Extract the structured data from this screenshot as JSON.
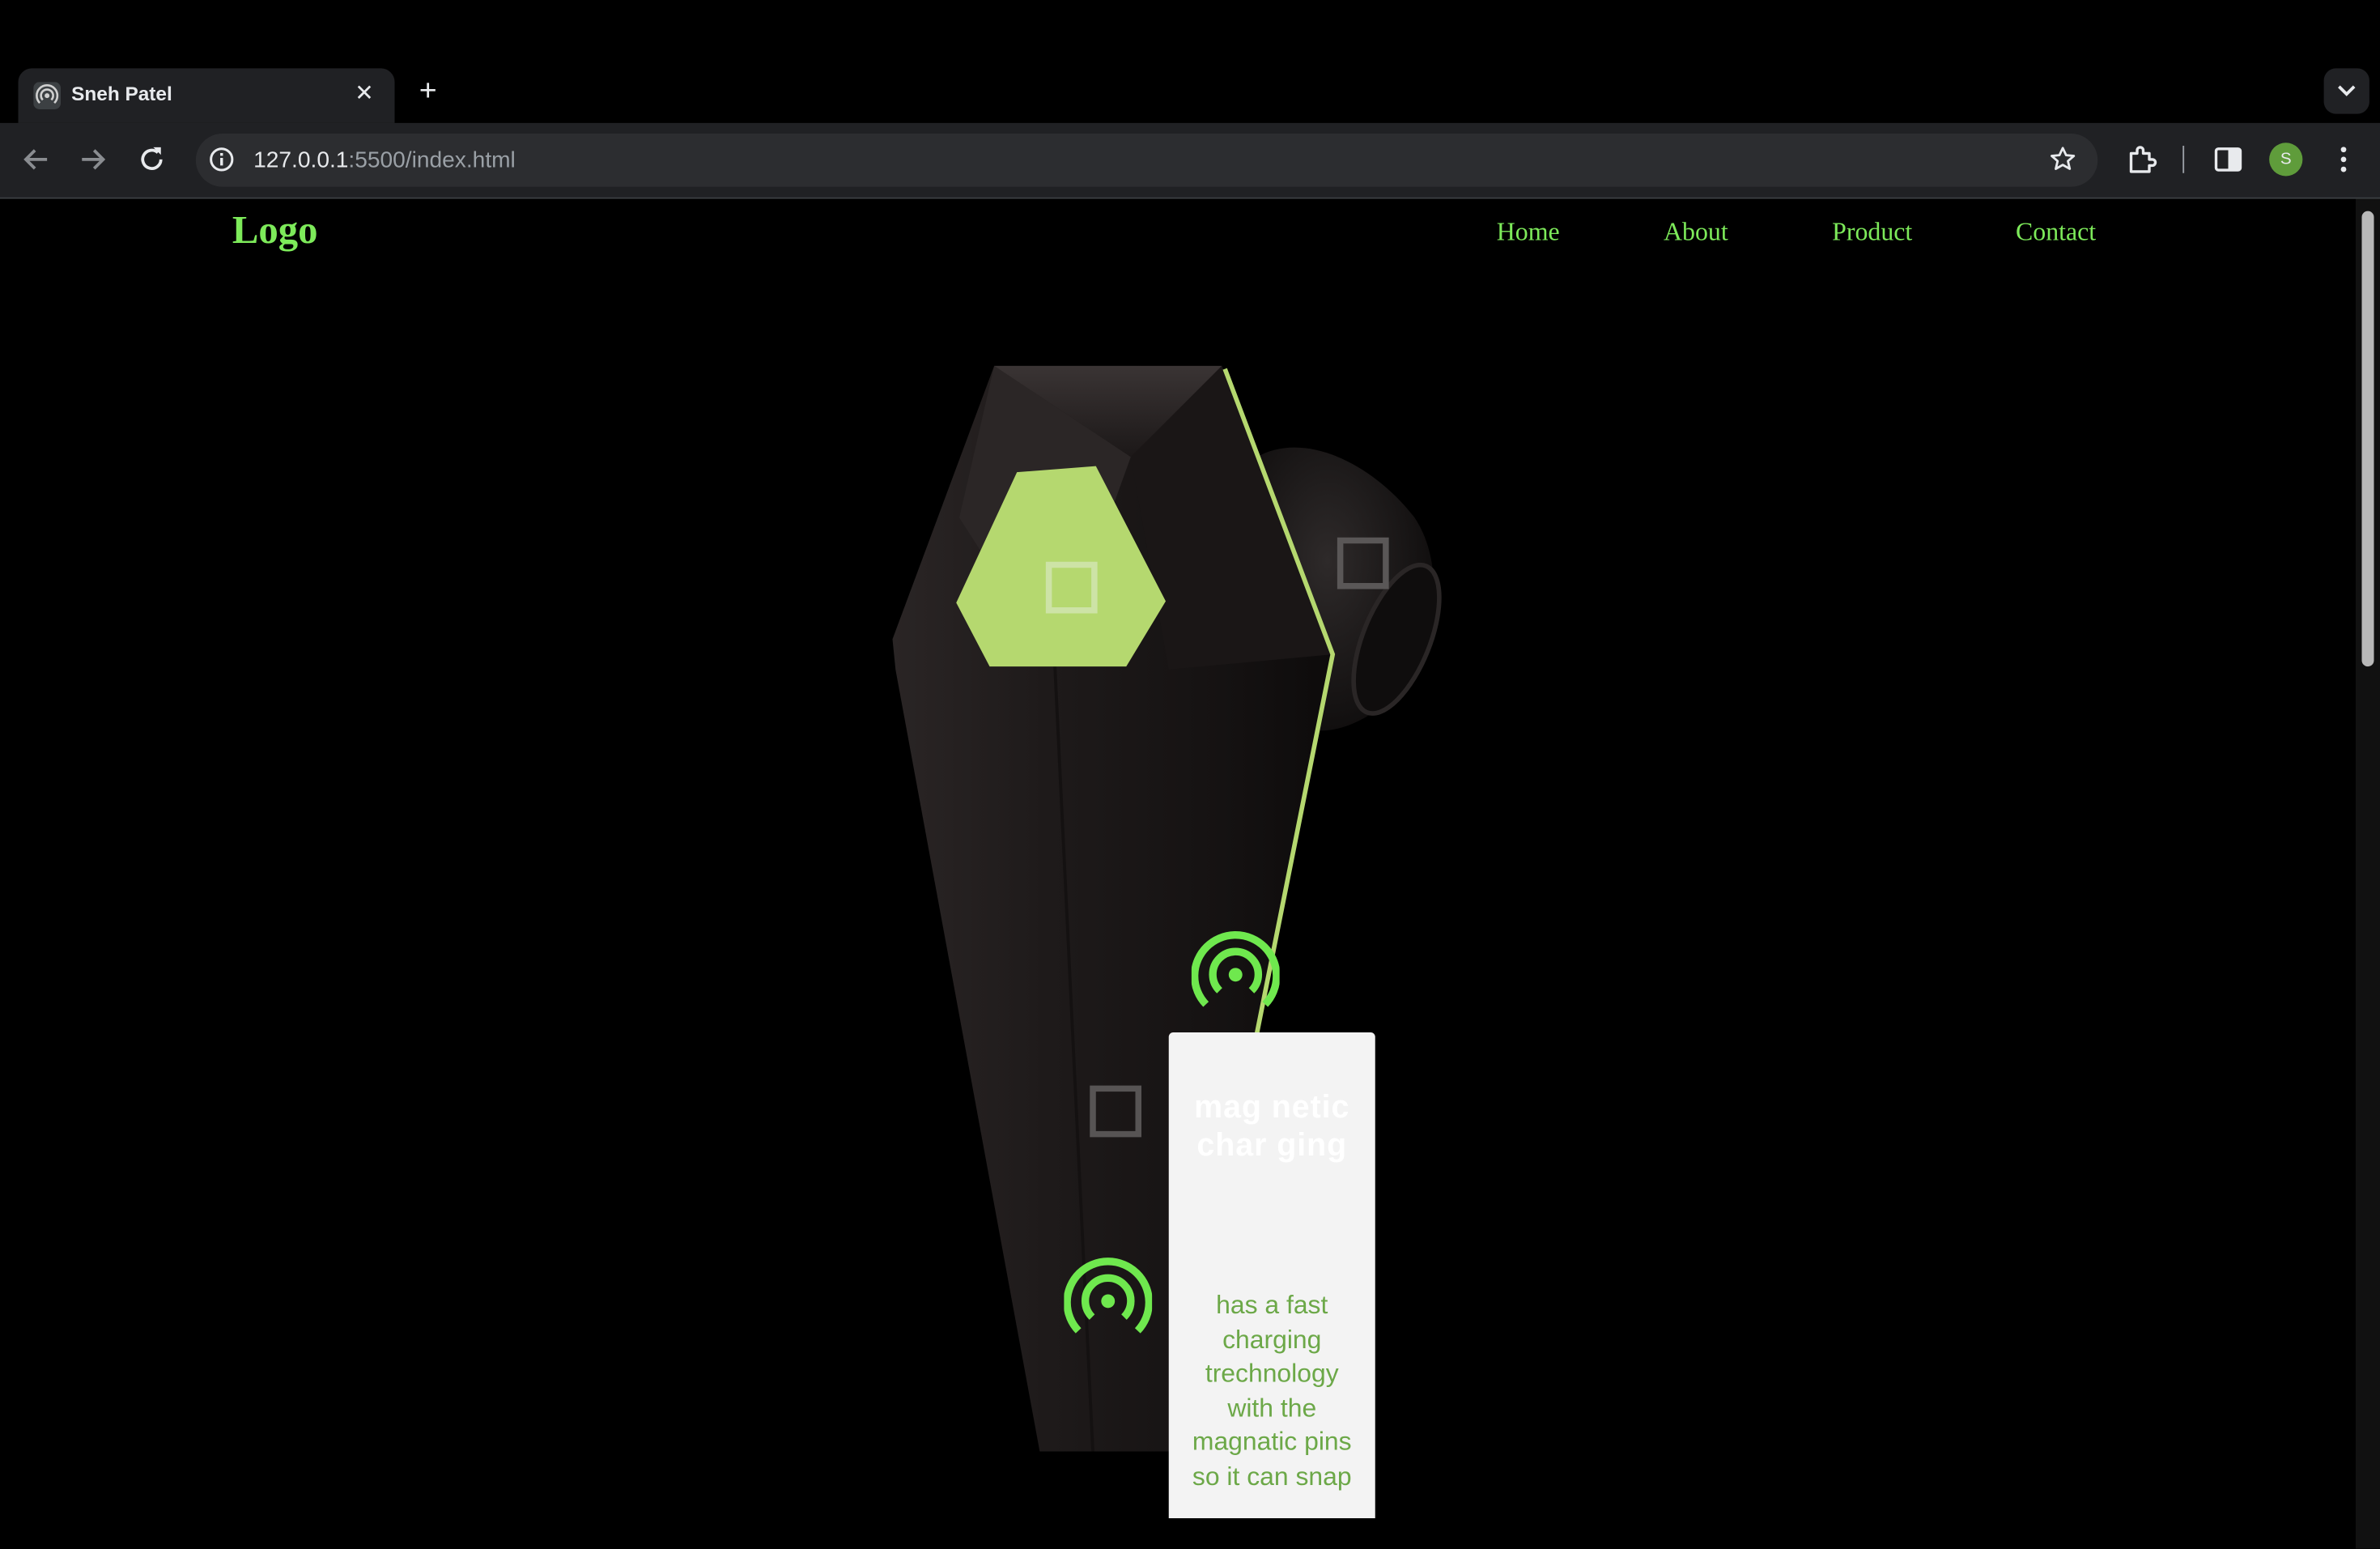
{
  "browser": {
    "tab_title": "Sneh Patel",
    "tab_close": "✕",
    "new_tab": "+",
    "url_host": "127.0.0.1",
    "url_path": ":5500/index.html",
    "profile_initial": "S"
  },
  "header": {
    "logo": "Logo",
    "nav": [
      "Home",
      "About",
      "Product",
      "Contact"
    ]
  },
  "colors": {
    "accent": "#7dea5a",
    "hex_button": "#b5d86f",
    "card_bg": "#f3f3f3",
    "card_body_text": "#6ca848"
  },
  "icons": {
    "hotspots": "broadcast-icon",
    "markers": "square-marker"
  },
  "feature_card": {
    "title": "mag netic char ging",
    "body": "has a fast charging trechnology with the magnatic pins so it can snap"
  }
}
